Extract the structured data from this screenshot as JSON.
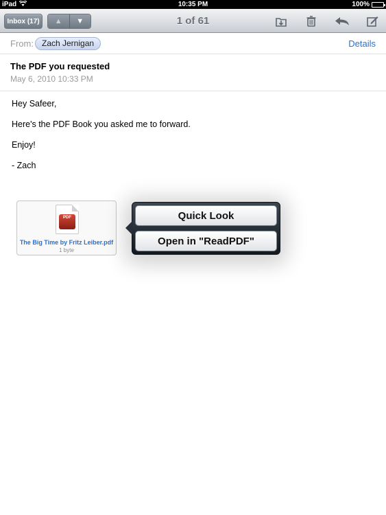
{
  "status_bar": {
    "device": "iPad",
    "time": "10:35 PM",
    "battery": "100%",
    "battery_level": 1.0
  },
  "toolbar": {
    "inbox_label": "Inbox (17)",
    "counter": "1 of 61",
    "icons": [
      "up-arrow",
      "down-arrow",
      "move-folder",
      "trash",
      "reply",
      "compose"
    ]
  },
  "message": {
    "from_label": "From:",
    "from_name": "Zach Jernigan",
    "details_link": "Details",
    "subject": "The PDF you requested",
    "date": "May 6, 2010 10:33 PM",
    "body": [
      "Hey Safeer,",
      "Here's the PDF Book you asked me to forward.",
      "Enjoy!",
      "- Zach"
    ]
  },
  "attachment": {
    "icon_text": "PDF",
    "filename": "The Big Time by Fritz Leiber.pdf",
    "size": "1 byte"
  },
  "popover": {
    "options": [
      "Quick Look",
      "Open in \"ReadPDF\""
    ]
  },
  "colors": {
    "link": "#2a6fd1",
    "toolbar_button": "#7f8892",
    "popover_bg": "#1e252d"
  }
}
